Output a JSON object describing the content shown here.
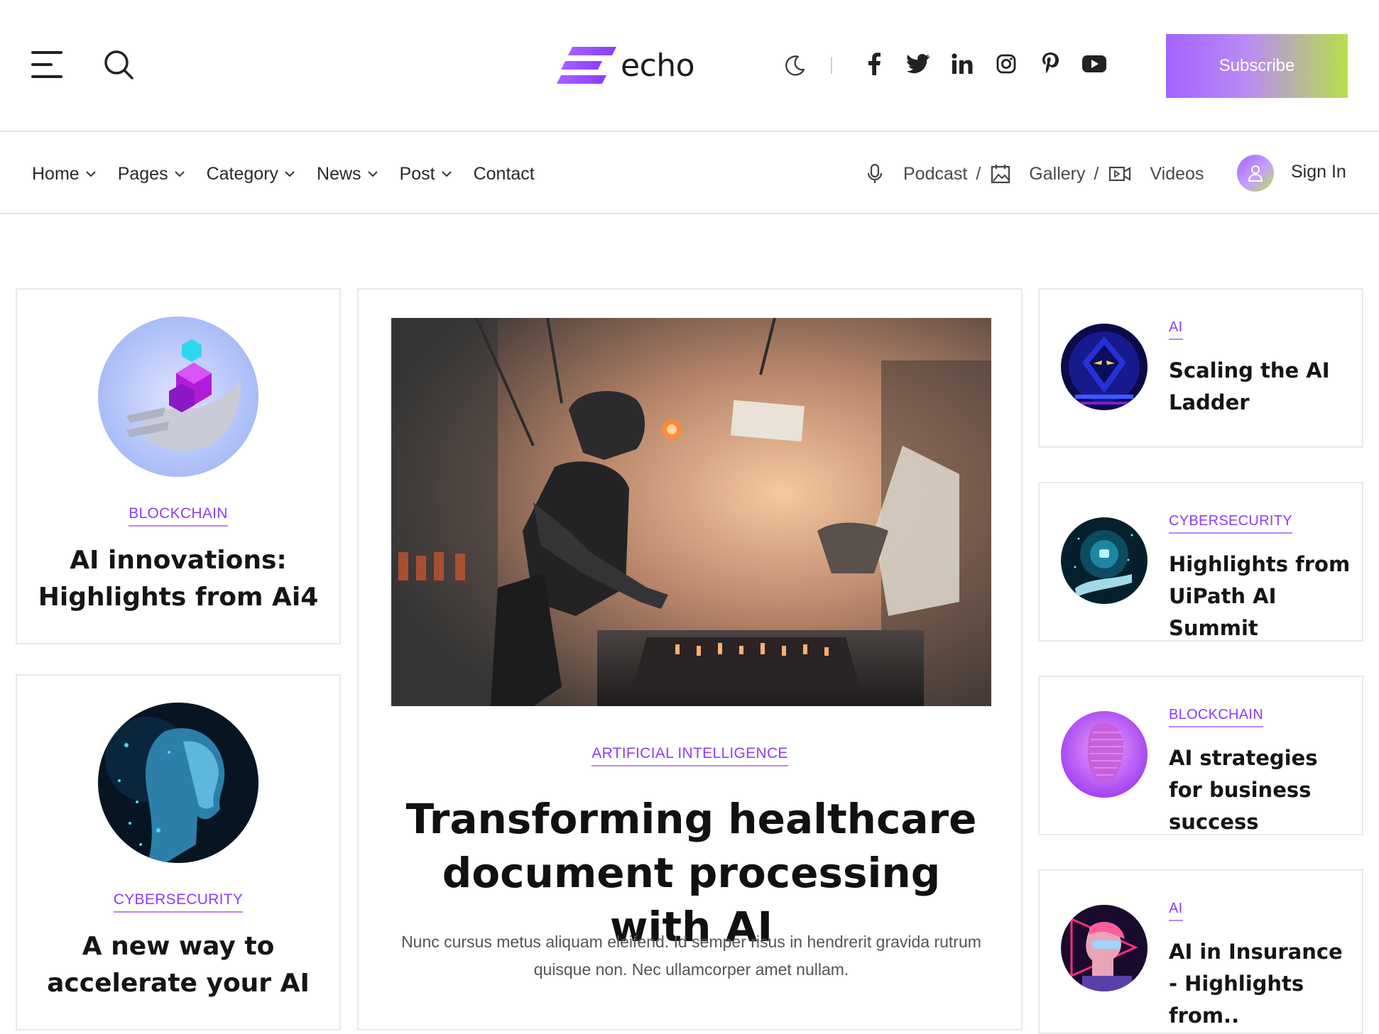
{
  "header": {
    "logo_text": "echo",
    "subscribe_label": "Subscribe",
    "social_icons": [
      "facebook-icon",
      "twitter-icon",
      "linkedin-icon",
      "instagram-icon",
      "pinterest-icon",
      "youtube-icon"
    ]
  },
  "nav": {
    "items": [
      {
        "label": "Home",
        "dropdown": true
      },
      {
        "label": "Pages",
        "dropdown": true
      },
      {
        "label": "Category",
        "dropdown": true
      },
      {
        "label": "News",
        "dropdown": true
      },
      {
        "label": "Post",
        "dropdown": true
      },
      {
        "label": "Contact",
        "dropdown": false
      }
    ],
    "media": [
      {
        "label": "Podcast",
        "icon": "microphone-icon"
      },
      {
        "label": "Gallery",
        "icon": "gallery-icon"
      },
      {
        "label": "Videos",
        "icon": "video-camera-icon"
      }
    ],
    "separator": "/",
    "signin_label": "Sign In"
  },
  "left_posts": [
    {
      "category": "BLOCKCHAIN",
      "title": "AI innovations: Highlights from Ai4"
    },
    {
      "category": "CYBERSECURITY",
      "title": "A new way to accelerate your AI"
    }
  ],
  "featured": {
    "category": "ARTIFICIAL INTELLIGENCE",
    "title": "Transforming healthcare document processing with AI",
    "excerpt": "Nunc cursus metus aliquam eleifend. Id semper risus in hendrerit gravida rutrum quisque non. Nec ullamcorper amet nullam."
  },
  "right_posts": [
    {
      "category": "AI",
      "title": "Scaling the AI Ladder"
    },
    {
      "category": "CYBERSECURITY",
      "title": "Highlights from UiPath AI Summit"
    },
    {
      "category": "BLOCKCHAIN",
      "title": "AI strategies for business success"
    },
    {
      "category": "AI",
      "title": "AI in Insurance - Highlights from.."
    }
  ],
  "colors": {
    "accent": "#8d3bff",
    "gradient_start": "#a463ff",
    "gradient_end": "#b7e04a",
    "border": "#e9e9e9"
  }
}
